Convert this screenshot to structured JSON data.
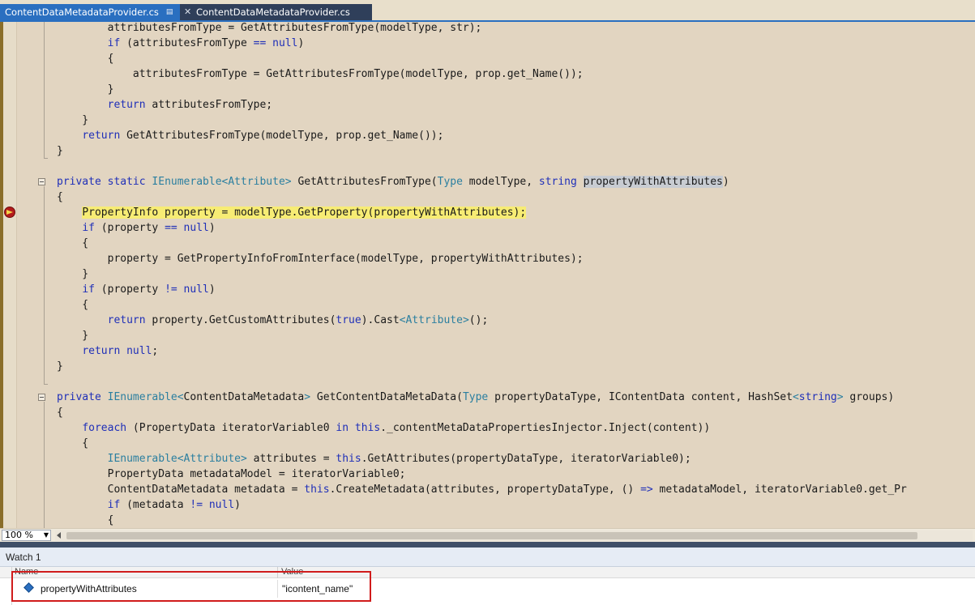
{
  "tabs": [
    {
      "label": "ContentDataMetadataProvider.cs",
      "active": true,
      "pin_icon": "pin-icon",
      "dock_icon": "dock-icon"
    },
    {
      "label": "ContentDataMetadataProvider.cs",
      "active": false,
      "close_icon": "close-icon"
    }
  ],
  "editor": {
    "lines": [
      "        attributesFromType = GetAttributesFromType(modelType, str);",
      "        if (attributesFromType == null)",
      "        {",
      "            attributesFromType = GetAttributesFromType(modelType, prop.get_Name());",
      "        }",
      "        return attributesFromType;",
      "    }",
      "    return GetAttributesFromType(modelType, prop.get_Name());",
      "}",
      "",
      "private static IEnumerable<Attribute> GetAttributesFromType(Type modelType, string propertyWithAttributes)",
      "{",
      "    PropertyInfo property = modelType.GetProperty(propertyWithAttributes);",
      "    if (property == null)",
      "    {",
      "        property = GetPropertyInfoFromInterface(modelType, propertyWithAttributes);",
      "    }",
      "    if (property != null)",
      "    {",
      "        return property.GetCustomAttributes(true).Cast<Attribute>();",
      "    }",
      "    return null;",
      "}",
      "",
      "private IEnumerable<ContentDataMetadata> GetContentDataMetaData(Type propertyDataType, IContentData content, HashSet<string> groups)",
      "{",
      "    foreach (PropertyData iteratorVariable0 in this._contentMetaDataPropertiesInjector.Inject(content))",
      "    {",
      "        IEnumerable<Attribute> attributes = this.GetAttributes(propertyDataType, iteratorVariable0);",
      "        PropertyData metadataModel = iteratorVariable0;",
      "        ContentDataMetadata metadata = this.CreateMetadata(attributes, propertyDataType, () => metadataModel, iteratorVariable0.get_Pr",
      "        if (metadata != null)",
      "        {"
    ],
    "current_line_index": 12,
    "breakpoint_icon": "current-statement-arrow-icon",
    "colors": {
      "keyword": "#1f2fb8",
      "type": "#2b7fa0",
      "current_line_highlight": "#f7ec74",
      "background": "#e2d5c1"
    }
  },
  "zoom": {
    "value": "100 %",
    "dropdown_icon": "chevron-down-icon"
  },
  "watch": {
    "title": "Watch 1",
    "columns": {
      "name": "Name",
      "value": "Value"
    },
    "rows": [
      {
        "name": "propertyWithAttributes",
        "value": "\"icontent_name\"",
        "icon": "field-icon"
      }
    ],
    "highlight_color": "#d01c1c"
  }
}
